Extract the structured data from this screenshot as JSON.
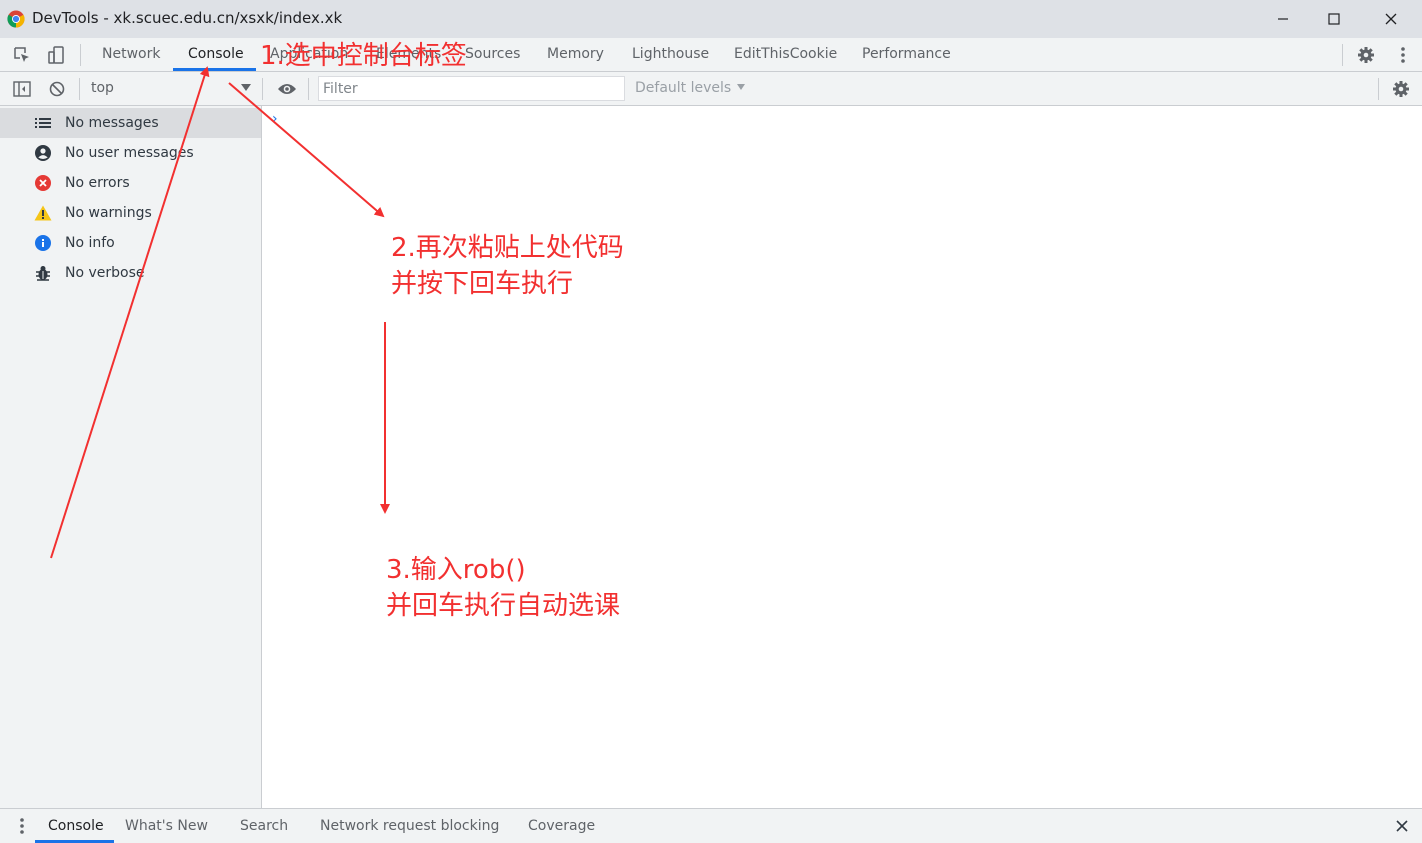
{
  "window": {
    "title": "DevTools - xk.scuec.edu.cn/xsxk/index.xk"
  },
  "tabs": [
    "Network",
    "Console",
    "Application",
    "Elements",
    "Sources",
    "Memory",
    "Lighthouse",
    "EditThisCookie",
    "Performance"
  ],
  "active_tab": "Console",
  "console_toolbar": {
    "context": "top",
    "filter_placeholder": "Filter",
    "levels": "Default levels"
  },
  "sidebar": {
    "items": [
      {
        "label": "No messages",
        "icon": "list-icon"
      },
      {
        "label": "No user messages",
        "icon": "user-icon"
      },
      {
        "label": "No errors",
        "icon": "error-icon"
      },
      {
        "label": "No warnings",
        "icon": "warning-icon"
      },
      {
        "label": "No info",
        "icon": "info-icon"
      },
      {
        "label": "No verbose",
        "icon": "bug-icon"
      }
    ]
  },
  "prompt": "›",
  "drawer": {
    "tabs": [
      "Console",
      "What's New",
      "Search",
      "Network request blocking",
      "Coverage"
    ]
  },
  "annotations": {
    "step1": "1.选中控制台标签",
    "step2_line1": "2.再次粘贴上处代码",
    "step2_line2": "并按下回车执行",
    "step3_line1": "3.输入rob()",
    "step3_line2": "并回车执行自动选课"
  },
  "colors": {
    "annotation": "#f23030",
    "accent": "#1a73e8",
    "chrome_bg": "#f1f3f4"
  }
}
